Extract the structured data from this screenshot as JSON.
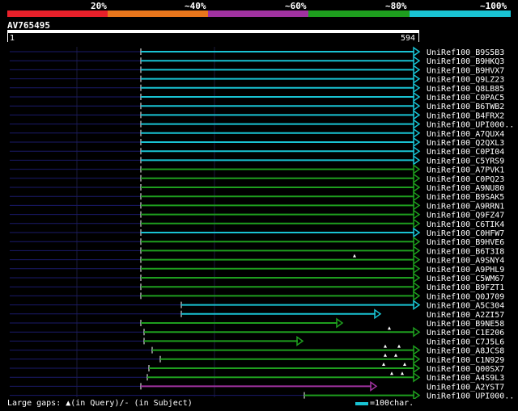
{
  "legend": {
    "labels": [
      "20%",
      "~40%",
      "~60%",
      "~80%",
      "~100%"
    ],
    "colors": [
      "#e8202a",
      "#e8761c",
      "#a032a0",
      "#1e9e1e",
      "#19c3d3"
    ]
  },
  "query": {
    "name": "AV765495",
    "start": "1",
    "end": "594"
  },
  "hits": [
    {
      "label": "UniRef100_B9S5B3",
      "color": "#19c3d3"
    },
    {
      "label": "UniRef100_B9HKQ3",
      "color": "#19c3d3"
    },
    {
      "label": "UniRef100_B9HVX7",
      "color": "#19c3d3"
    },
    {
      "label": "UniRef100_Q9LZ23",
      "color": "#19c3d3"
    },
    {
      "label": "UniRef100_Q8LB85",
      "color": "#19c3d3"
    },
    {
      "label": "UniRef100_C0PAC5",
      "color": "#19c3d3"
    },
    {
      "label": "UniRef100_B6TWB2",
      "color": "#19c3d3"
    },
    {
      "label": "UniRef100_B4FRX2",
      "color": "#19c3d3"
    },
    {
      "label": "UniRef100_UPI000..",
      "color": "#19c3d3"
    },
    {
      "label": "UniRef100_A7QUX4",
      "color": "#19c3d3"
    },
    {
      "label": "UniRef100_Q2QXL3",
      "color": "#19c3d3"
    },
    {
      "label": "UniRef100_C0PI04",
      "color": "#19c3d3"
    },
    {
      "label": "UniRef100_C5YRS9",
      "color": "#19c3d3"
    },
    {
      "label": "UniRef100_A7PVK1",
      "color": "#1e9e1e"
    },
    {
      "label": "UniRef100_C0PQ23",
      "color": "#1e9e1e"
    },
    {
      "label": "UniRef100_A9NU80",
      "color": "#1e9e1e"
    },
    {
      "label": "UniRef100_B9SAK5",
      "color": "#1e9e1e"
    },
    {
      "label": "UniRef100_A9RRN1",
      "color": "#1e9e1e"
    },
    {
      "label": "UniRef100_Q9FZ47",
      "color": "#1e9e1e"
    },
    {
      "label": "UniRef100_C6TIK4",
      "color": "#1e9e1e"
    },
    {
      "label": "UniRef100_C0HFW7",
      "color": "#19c3d3"
    },
    {
      "label": "UniRef100_B9HVE6",
      "color": "#1e9e1e"
    },
    {
      "label": "UniRef100_B6T3I8",
      "color": "#1e9e1e"
    },
    {
      "label": "UniRef100_A9SNY4",
      "color": "#1e9e1e"
    },
    {
      "label": "UniRef100_A9PHL9",
      "color": "#1e9e1e"
    },
    {
      "label": "UniRef100_C5WM67",
      "color": "#1e9e1e"
    },
    {
      "label": "UniRef100_B9FZT1",
      "color": "#1e9e1e"
    },
    {
      "label": "UniRef100_Q0J709",
      "color": "#1e9e1e"
    },
    {
      "label": "UniRef100_A5C304",
      "color": "#19c3d3"
    },
    {
      "label": "UniRef100_A2ZI57",
      "color": "#19c3d3"
    },
    {
      "label": "UniRef100_B9NE58",
      "color": "#1e9e1e"
    },
    {
      "label": "UniRef100_C1E206",
      "color": "#1e9e1e"
    },
    {
      "label": "UniRef100_C7J5L6",
      "color": "#1e9e1e"
    },
    {
      "label": "UniRef100_A8JCS8",
      "color": "#1e9e1e"
    },
    {
      "label": "UniRef100_C1N929",
      "color": "#1e9e1e"
    },
    {
      "label": "UniRef100_Q00SX7",
      "color": "#1e9e1e"
    },
    {
      "label": "UniRef100_A4S9L3",
      "color": "#1e9e1e"
    },
    {
      "label": "UniRef100_A2YST7",
      "color": "#a032a0"
    },
    {
      "label": "UniRef100_UPI000..",
      "color": "#1e9e1e"
    }
  ],
  "footer": {
    "gaps_text": "Large gaps: ▲(in Query)/- (in Subject)",
    "scale_text": "=100char.",
    "scale_color": "#19c3d3"
  }
}
